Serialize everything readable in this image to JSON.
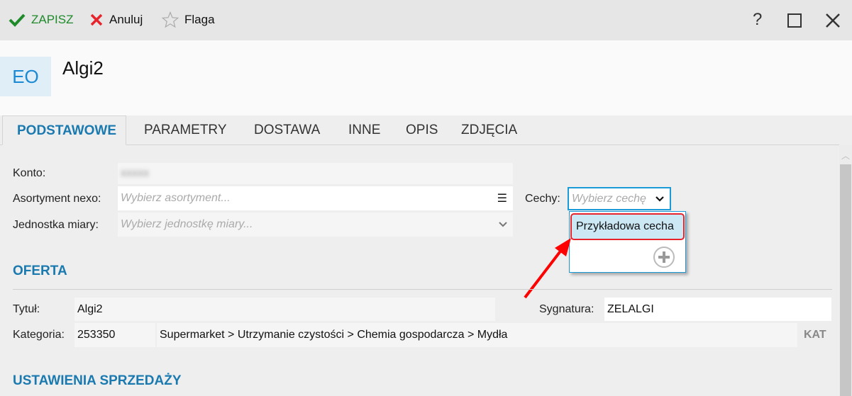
{
  "toolbar": {
    "save": "ZAPISZ",
    "cancel": "Anuluj",
    "flag": "Flaga",
    "help": "?"
  },
  "header": {
    "badge": "EO",
    "title": "Algi2"
  },
  "tabs": [
    "PODSTAWOWE",
    "PARAMETRY",
    "DOSTAWA",
    "INNE",
    "OPIS",
    "ZDJĘCIA"
  ],
  "form": {
    "konto_label": "Konto:",
    "konto_value": "",
    "asortyment_label": "Asortyment nexo:",
    "asortyment_placeholder": "Wybierz asortyment...",
    "jednostka_label": "Jednostka miary:",
    "jednostka_placeholder": "Wybierz jednostkę miary...",
    "cechy_label": "Cechy:",
    "cechy_placeholder": "Wybierz cechę",
    "cechy_options": [
      "Przykładowa cecha"
    ]
  },
  "oferta": {
    "heading": "OFERTA",
    "tytul_label": "Tytuł:",
    "tytul_value": "Algi2",
    "sygnatura_label": "Sygnatura:",
    "sygnatura_value": "ZELALGI",
    "kategoria_label": "Kategoria:",
    "kategoria_id": "253350",
    "kategoria_path": "Supermarket > Utrzymanie czystości > Chemia gospodarcza > Mydła",
    "kat_button": "KAT"
  },
  "sales": {
    "heading": "USTAWIENIA SPRZEDAŻY"
  },
  "colors": {
    "accent": "#1a7ab0",
    "save": "#1e8a2a",
    "cancel": "#e8232b",
    "highlight": "#cde8f5",
    "annotation": "#ff0000"
  }
}
